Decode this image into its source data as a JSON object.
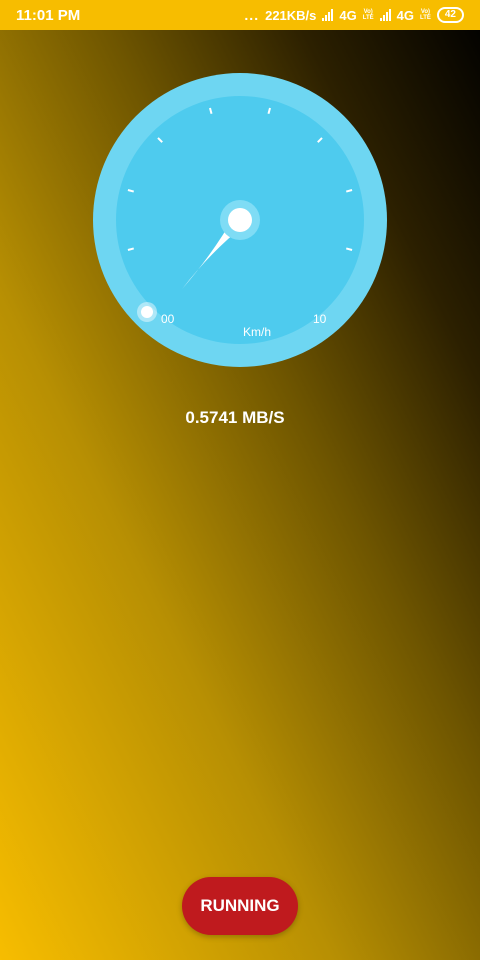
{
  "status_bar": {
    "time": "11:01 PM",
    "dots": "...",
    "net_speed": "221KB/s",
    "network1": "4G",
    "volte1": [
      "Vo)",
      "LTE"
    ],
    "network2": "4G",
    "volte2": [
      "Vo)",
      "LTE"
    ],
    "battery": "42"
  },
  "gauge": {
    "min_label": "00",
    "max_label": "10",
    "unit": "Km/h",
    "needle_value": 0.2,
    "colors": {
      "face": "#4ecbee",
      "ring": "#6ed6f2",
      "ticks": "#ffffff"
    }
  },
  "speed_readout": "0.5741 MB/S",
  "button": {
    "label": "RUNNING",
    "color": "#bf1a1e"
  }
}
